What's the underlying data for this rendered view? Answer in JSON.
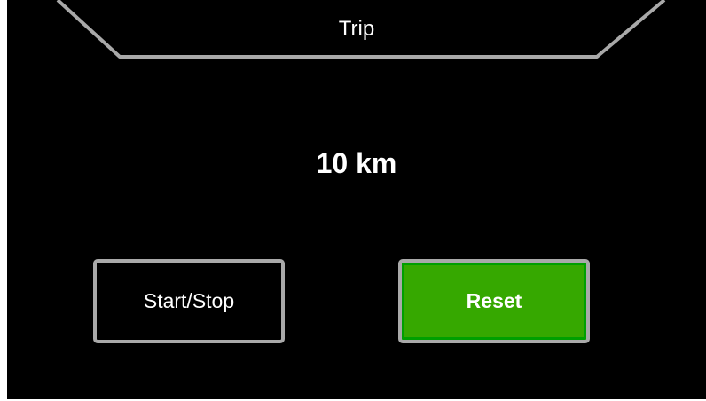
{
  "header": {
    "title": "Trip"
  },
  "trip": {
    "distance": "10 km"
  },
  "buttons": {
    "start_stop_label": "Start/Stop",
    "reset_label": "Reset"
  },
  "colors": {
    "background": "#000000",
    "frame": "#a9a9a9",
    "reset_button": "#36a800",
    "text": "#ffffff"
  }
}
